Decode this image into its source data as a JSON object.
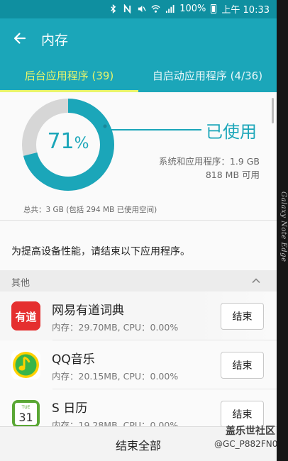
{
  "status_bar": {
    "battery": "100%",
    "time": "上午 10:33",
    "icons": [
      "bluetooth-icon",
      "nfc-icon",
      "mute-icon",
      "wifi-icon",
      "signal-icon",
      "battery-icon"
    ]
  },
  "app_bar": {
    "title": "内存",
    "back_icon": "arrow-left-icon"
  },
  "tabs": [
    {
      "label": "后台应用程序 (39)",
      "active": true
    },
    {
      "label": "自启动应用程序 (4/36)",
      "active": false
    }
  ],
  "memory": {
    "percent_value": "71",
    "percent_unit": "%",
    "used_fraction": 0.71,
    "used_label": "已使用",
    "system_usage": "系统和应用程序：1.9 GB",
    "available": "818 MB 可用",
    "total": "总共：3 GB (包括 294 MB 已使用空间)"
  },
  "prompt": "为提高设备性能，请结束以下应用程序。",
  "section": {
    "title": "其他",
    "toggle_icon": "chevron-up-icon"
  },
  "apps": [
    {
      "name": "网易有道词典",
      "usage": "内存：29.70MB, CPU：0.00%",
      "icon": "youdao-icon",
      "icon_text": "有道",
      "button": "结束"
    },
    {
      "name": "QQ音乐",
      "usage": "内存：20.15MB, CPU：0.00%",
      "icon": "qq-music-icon",
      "button": "结束"
    },
    {
      "name": "S 日历",
      "usage": "内存：19.28MB, CPU：0.00%",
      "icon": "calendar-icon",
      "icon_day": "TUE",
      "icon_date": "31",
      "button": "结束"
    }
  ],
  "bottom": {
    "end_all_label": "结束全部"
  },
  "edge_brand": "Galaxy Note Edge",
  "watermark": {
    "line1": "盖乐世社区",
    "line2": "@GC_P882FN0"
  },
  "colors": {
    "status_bar": "#0f8fa0",
    "app_bar": "#1ba6b9",
    "accent": "#1ba6b9",
    "tab_active": "#e9f56a",
    "donut_remaining": "#d6d6d6",
    "youdao": "#e52f2f",
    "qq_music": "#ffd100",
    "calendar": "#5aa735"
  }
}
